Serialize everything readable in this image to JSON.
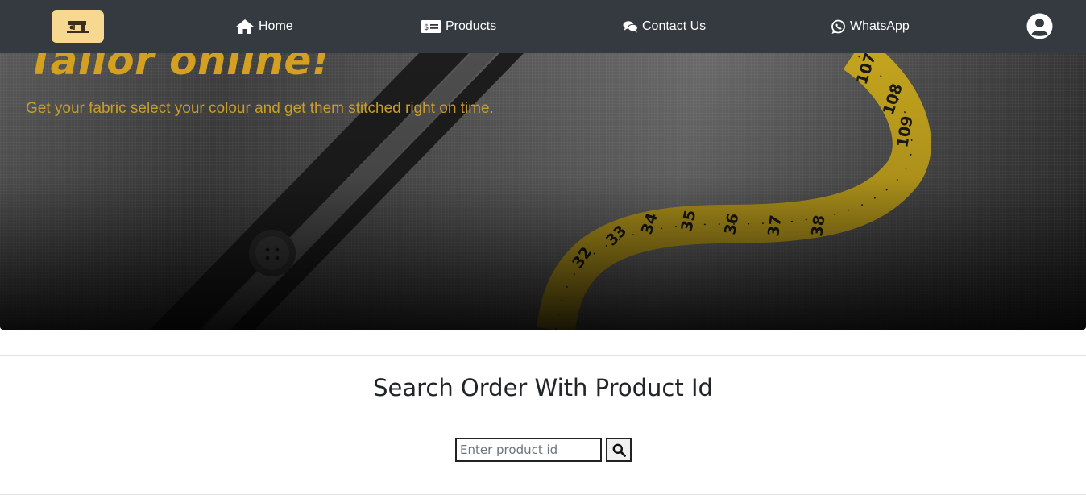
{
  "nav": {
    "logo_icon": "sewing-machine-icon",
    "items": [
      {
        "label": "Home",
        "icon": "home-icon"
      },
      {
        "label": "Products",
        "icon": "price-tag-icon"
      },
      {
        "label": "Contact Us",
        "icon": "chat-bubbles-icon"
      },
      {
        "label": "WhatsApp",
        "icon": "whatsapp-icon"
      }
    ],
    "user_icon": "user-circle-icon"
  },
  "hero": {
    "title": "Tailor online!",
    "subtitle": "Get your fabric select your colour and get them stitched right on time.",
    "tape_numbers": [
      "32",
      "33",
      "34",
      "35",
      "36",
      "37",
      "38",
      "107",
      "108",
      "109"
    ],
    "accent_color": "#d4a021"
  },
  "search": {
    "title": "Search Order With Product Id",
    "placeholder": "Enter product id",
    "value": "",
    "button_icon": "search-icon"
  },
  "colors": {
    "navbar": "#343a40",
    "logo_bg": "#f6d891",
    "text_dark": "#212529"
  }
}
